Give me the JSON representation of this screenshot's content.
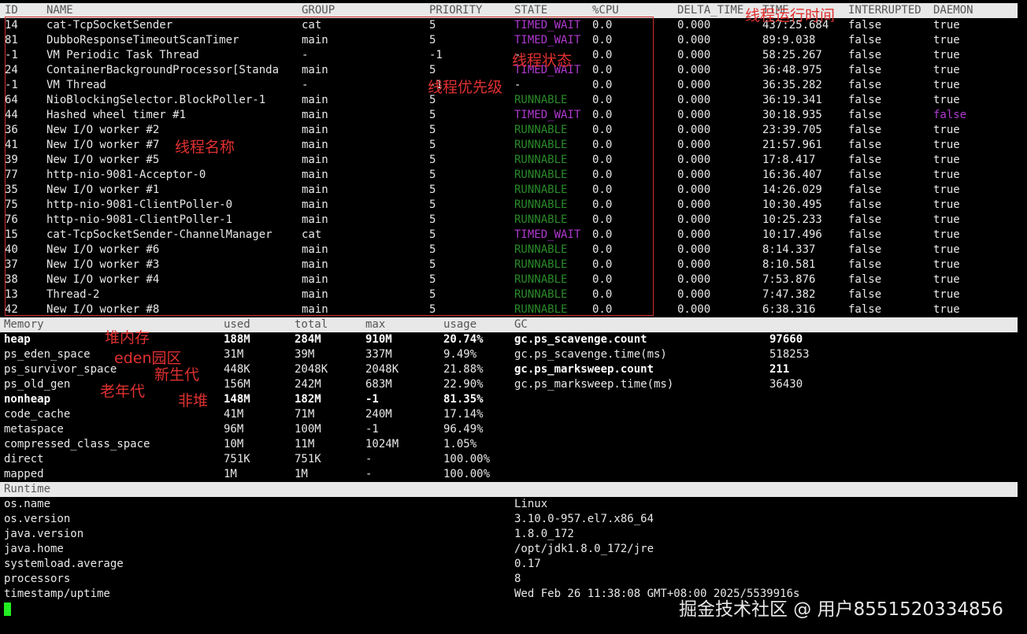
{
  "thread_table": {
    "headers": [
      "ID",
      "NAME",
      "GROUP",
      "PRIORITY",
      "STATE",
      "%CPU",
      "DELTA_TIME",
      "TIME",
      "INTERRUPTED",
      "DAEMON"
    ],
    "rows": [
      [
        "14",
        "cat-TcpSocketSender",
        "cat",
        "5",
        "TIMED_WAIT",
        "0.0",
        "0.000",
        "437:25.684",
        "false",
        "true"
      ],
      [
        "81",
        "DubboResponseTimeoutScanTimer",
        "main",
        "5",
        "TIMED_WAIT",
        "0.0",
        "0.000",
        "89:9.038",
        "false",
        "true"
      ],
      [
        "-1",
        "VM Periodic Task Thread",
        "-",
        "-1",
        "-",
        "0.0",
        "0.000",
        "58:25.267",
        "false",
        "true"
      ],
      [
        "24",
        "ContainerBackgroundProcessor[Standa",
        "main",
        "5",
        "TIMED_WAIT",
        "0.0",
        "0.000",
        "36:48.975",
        "false",
        "true"
      ],
      [
        "-1",
        "VM Thread",
        "-",
        "-1",
        "-",
        "0.0",
        "0.000",
        "36:35.282",
        "false",
        "true"
      ],
      [
        "64",
        "NioBlockingSelector.BlockPoller-1",
        "main",
        "5",
        "RUNNABLE",
        "0.0",
        "0.000",
        "36:19.341",
        "false",
        "true"
      ],
      [
        "44",
        "Hashed wheel timer #1",
        "main",
        "5",
        "TIMED_WAIT",
        "0.0",
        "0.000",
        "30:18.935",
        "false",
        "false"
      ],
      [
        "36",
        "New I/O worker #2",
        "main",
        "5",
        "RUNNABLE",
        "0.0",
        "0.000",
        "23:39.705",
        "false",
        "true"
      ],
      [
        "41",
        "New I/O worker #7",
        "main",
        "5",
        "RUNNABLE",
        "0.0",
        "0.000",
        "21:57.961",
        "false",
        "true"
      ],
      [
        "39",
        "New I/O worker #5",
        "main",
        "5",
        "RUNNABLE",
        "0.0",
        "0.000",
        "17:8.417",
        "false",
        "true"
      ],
      [
        "77",
        "http-nio-9081-Acceptor-0",
        "main",
        "5",
        "RUNNABLE",
        "0.0",
        "0.000",
        "16:36.407",
        "false",
        "true"
      ],
      [
        "35",
        "New I/O worker #1",
        "main",
        "5",
        "RUNNABLE",
        "0.0",
        "0.000",
        "14:26.029",
        "false",
        "true"
      ],
      [
        "75",
        "http-nio-9081-ClientPoller-0",
        "main",
        "5",
        "RUNNABLE",
        "0.0",
        "0.000",
        "10:30.495",
        "false",
        "true"
      ],
      [
        "76",
        "http-nio-9081-ClientPoller-1",
        "main",
        "5",
        "RUNNABLE",
        "0.0",
        "0.000",
        "10:25.233",
        "false",
        "true"
      ],
      [
        "15",
        "cat-TcpSocketSender-ChannelManager",
        "cat",
        "5",
        "TIMED_WAIT",
        "0.0",
        "0.000",
        "10:17.496",
        "false",
        "true"
      ],
      [
        "40",
        "New I/O worker #6",
        "main",
        "5",
        "RUNNABLE",
        "0.0",
        "0.000",
        "8:14.337",
        "false",
        "true"
      ],
      [
        "37",
        "New I/O worker #3",
        "main",
        "5",
        "RUNNABLE",
        "0.0",
        "0.000",
        "8:10.581",
        "false",
        "true"
      ],
      [
        "38",
        "New I/O worker #4",
        "main",
        "5",
        "RUNNABLE",
        "0.0",
        "0.000",
        "7:53.876",
        "false",
        "true"
      ],
      [
        "13",
        "Thread-2",
        "main",
        "5",
        "RUNNABLE",
        "0.0",
        "0.000",
        "7:47.382",
        "false",
        "true"
      ],
      [
        "42",
        "New I/O worker #8",
        "main",
        "5",
        "RUNNABLE",
        "0.0",
        "0.000",
        "6:38.316",
        "false",
        "true"
      ]
    ]
  },
  "memory_table": {
    "headers": [
      "Memory",
      "used",
      "total",
      "max",
      "usage"
    ],
    "rows": [
      {
        "cells": [
          "heap",
          "188M",
          "284M",
          "910M",
          "20.74%"
        ],
        "bold": true
      },
      {
        "cells": [
          "ps_eden_space",
          "31M",
          "39M",
          "337M",
          "9.49%"
        ],
        "bold": false
      },
      {
        "cells": [
          "ps_survivor_space",
          "448K",
          "2048K",
          "2048K",
          "21.88%"
        ],
        "bold": false
      },
      {
        "cells": [
          "ps_old_gen",
          "156M",
          "242M",
          "683M",
          "22.90%"
        ],
        "bold": false
      },
      {
        "cells": [
          "nonheap",
          "148M",
          "182M",
          "-1",
          "81.35%"
        ],
        "bold": true
      },
      {
        "cells": [
          "code_cache",
          "41M",
          "71M",
          "240M",
          "17.14%"
        ],
        "bold": false
      },
      {
        "cells": [
          "metaspace",
          "96M",
          "100M",
          "-1",
          "96.49%"
        ],
        "bold": false
      },
      {
        "cells": [
          "compressed_class_space",
          "10M",
          "11M",
          "1024M",
          "1.05%"
        ],
        "bold": false
      },
      {
        "cells": [
          "direct",
          "751K",
          "751K",
          "-",
          "100.00%"
        ],
        "bold": false
      },
      {
        "cells": [
          "mapped",
          "1M",
          "1M",
          "-",
          "100.00%"
        ],
        "bold": false
      }
    ]
  },
  "gc_table": {
    "header": "GC",
    "rows": [
      {
        "name": "gc.ps_scavenge.count",
        "value": "97660",
        "bold": true
      },
      {
        "name": "gc.ps_scavenge.time(ms)",
        "value": "518253",
        "bold": false
      },
      {
        "name": "gc.ps_marksweep.count",
        "value": "211",
        "bold": true
      },
      {
        "name": "gc.ps_marksweep.time(ms)",
        "value": "36430",
        "bold": false
      }
    ]
  },
  "runtime": {
    "header": "Runtime",
    "rows": [
      [
        "os.name",
        "Linux"
      ],
      [
        "os.version",
        "3.10.0-957.el7.x86_64"
      ],
      [
        "java.version",
        "1.8.0_172"
      ],
      [
        "java.home",
        "/opt/jdk1.8.0_172/jre"
      ],
      [
        "systemload.average",
        "0.17"
      ],
      [
        "processors",
        "8"
      ],
      [
        "timestamp/uptime",
        "Wed Feb 26 11:38:08 GMT+08:00 2025/5539916s"
      ]
    ]
  },
  "annotations": {
    "thread_time": "线程运行时间",
    "thread_state": "线程状态",
    "thread_priority": "线程优先级",
    "thread_name": "线程名称",
    "heap": "堆内存",
    "eden": "eden园区",
    "young_gen": "新生代",
    "old_gen": "老年代",
    "nonheap": "非堆"
  },
  "watermark": "掘金技术社区 @ 用户8551520334856",
  "colors": {
    "timed_wait": "#b03ad0",
    "runnable": "#2a8a2a",
    "annotation": "#e03030",
    "cursor": "#22ee22"
  }
}
